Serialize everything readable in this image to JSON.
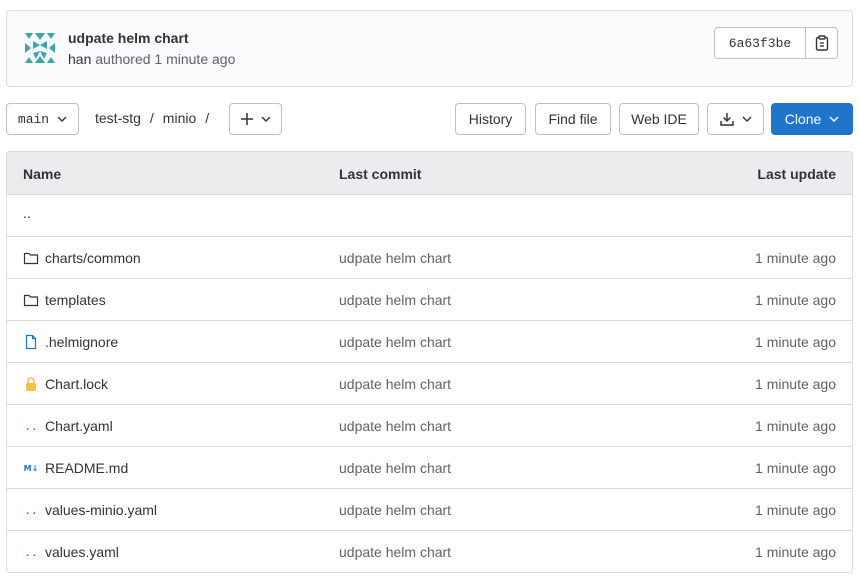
{
  "commit": {
    "title": "udpate helm chart",
    "author": "han",
    "authored_text": "authored 1 minute ago",
    "sha": "6a63f3be"
  },
  "toolbar": {
    "branch": "main",
    "breadcrumb": [
      "test-stg",
      "minio"
    ],
    "breadcrumb_sep": "/",
    "history_label": "History",
    "find_file_label": "Find file",
    "web_ide_label": "Web IDE",
    "clone_label": "Clone",
    "clone_color": "#1f75cb"
  },
  "table": {
    "headers": {
      "name": "Name",
      "last_commit": "Last commit",
      "last_update": "Last update"
    },
    "parent_dir": "..",
    "rows": [
      {
        "name": "charts/common",
        "icon": "folder-icon",
        "commit": "udpate helm chart",
        "updated": "1 minute ago"
      },
      {
        "name": "templates",
        "icon": "folder-icon",
        "commit": "udpate helm chart",
        "updated": "1 minute ago"
      },
      {
        "name": ".helmignore",
        "icon": "file-icon",
        "commit": "udpate helm chart",
        "updated": "1 minute ago"
      },
      {
        "name": "Chart.lock",
        "icon": "lock-icon",
        "commit": "udpate helm chart",
        "updated": "1 minute ago"
      },
      {
        "name": "Chart.yaml",
        "icon": "yaml-icon",
        "commit": "udpate helm chart",
        "updated": "1 minute ago"
      },
      {
        "name": "README.md",
        "icon": "markdown-icon",
        "commit": "udpate helm chart",
        "updated": "1 minute ago"
      },
      {
        "name": "values-minio.yaml",
        "icon": "yaml-icon",
        "commit": "udpate helm chart",
        "updated": "1 minute ago"
      },
      {
        "name": "values.yaml",
        "icon": "yaml-icon",
        "commit": "udpate helm chart",
        "updated": "1 minute ago"
      }
    ]
  }
}
